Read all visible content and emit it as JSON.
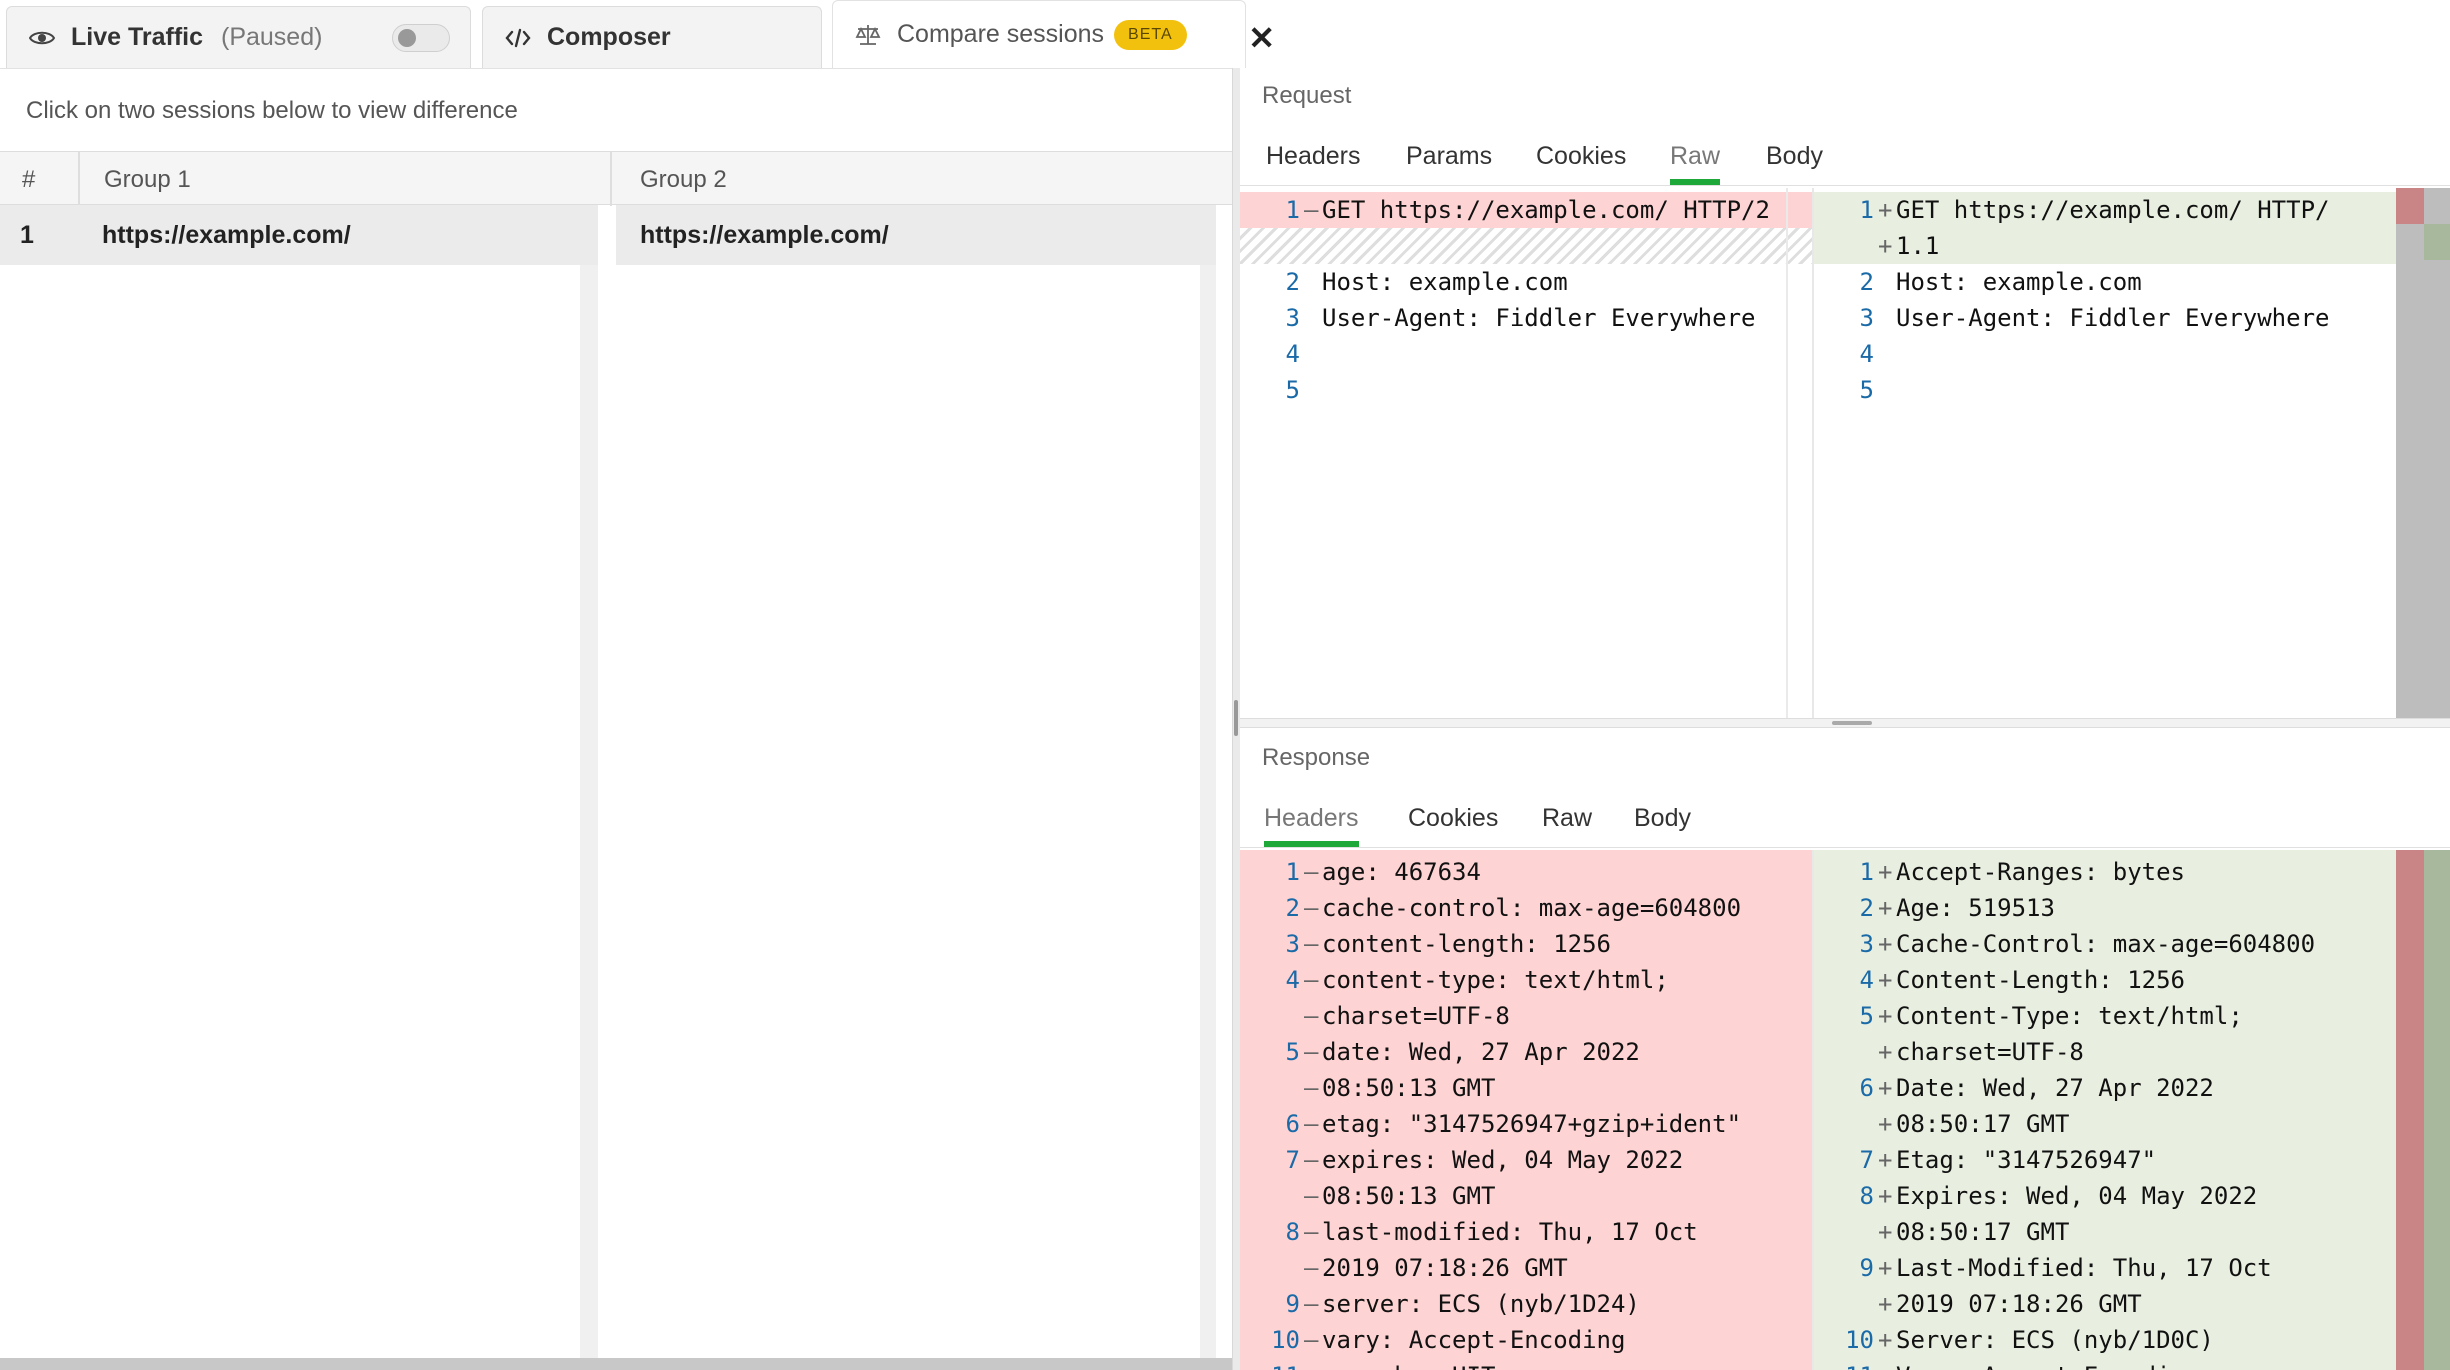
{
  "tabs": {
    "live_label": "Live Traffic",
    "live_state": "(Paused)",
    "composer_label": "Composer",
    "compare_label": "Compare sessions",
    "compare_badge": "BETA",
    "close_glyph": "✕"
  },
  "left": {
    "hint": "Click on two sessions below to view difference",
    "columns": {
      "hash": "#",
      "group1": "Group 1",
      "group2": "Group 2"
    },
    "rows": [
      {
        "num": "1",
        "group1": "https://example.com/",
        "group2": "https://example.com/"
      }
    ]
  },
  "request": {
    "title": "Request",
    "tabs": [
      "Headers",
      "Params",
      "Cookies",
      "Raw",
      "Body"
    ],
    "active_tab": "Raw",
    "left_lines": [
      {
        "ln": "1",
        "mk": "—",
        "text": "GET https://example.com/ HTTP/2",
        "type": "del"
      },
      {
        "ln": "",
        "mk": "",
        "text": "",
        "type": "hatch"
      },
      {
        "ln": "2",
        "mk": "",
        "text": "Host: example.com",
        "type": "same"
      },
      {
        "ln": "3",
        "mk": "",
        "text": "User-Agent: Fiddler Everywhere",
        "type": "same"
      },
      {
        "ln": "4",
        "mk": "",
        "text": "",
        "type": "same"
      },
      {
        "ln": "5",
        "mk": "",
        "text": "",
        "type": "same"
      }
    ],
    "right_lines": [
      {
        "ln": "1",
        "mk": "+",
        "text": "GET https://example.com/ HTTP/",
        "type": "add"
      },
      {
        "ln": "",
        "mk": "+",
        "text": "1.1",
        "type": "add"
      },
      {
        "ln": "2",
        "mk": "",
        "text": "Host: example.com",
        "type": "same"
      },
      {
        "ln": "3",
        "mk": "",
        "text": "User-Agent: Fiddler Everywhere",
        "type": "same"
      },
      {
        "ln": "4",
        "mk": "",
        "text": "",
        "type": "same"
      },
      {
        "ln": "5",
        "mk": "",
        "text": "",
        "type": "same"
      }
    ]
  },
  "response": {
    "title": "Response",
    "tabs": [
      "Headers",
      "Cookies",
      "Raw",
      "Body"
    ],
    "active_tab": "Headers",
    "left_lines": [
      {
        "ln": "1",
        "mk": "—",
        "text": "age: 467634"
      },
      {
        "ln": "2",
        "mk": "—",
        "text": "cache-control: max-age=604800"
      },
      {
        "ln": "3",
        "mk": "—",
        "text": "content-length: 1256"
      },
      {
        "ln": "4",
        "mk": "—",
        "text": "content-type: text/html;"
      },
      {
        "ln": "",
        "mk": "—",
        "text": "charset=UTF-8"
      },
      {
        "ln": "5",
        "mk": "—",
        "text": "date: Wed, 27 Apr 2022"
      },
      {
        "ln": "",
        "mk": "—",
        "text": "08:50:13 GMT"
      },
      {
        "ln": "6",
        "mk": "—",
        "text": "etag: \"3147526947+gzip+ident\""
      },
      {
        "ln": "7",
        "mk": "—",
        "text": "expires: Wed, 04 May 2022"
      },
      {
        "ln": "",
        "mk": "—",
        "text": "08:50:13 GMT"
      },
      {
        "ln": "8",
        "mk": "—",
        "text": "last-modified: Thu, 17 Oct"
      },
      {
        "ln": "",
        "mk": "—",
        "text": "2019 07:18:26 GMT"
      },
      {
        "ln": "9",
        "mk": "—",
        "text": "server: ECS (nyb/1D24)"
      },
      {
        "ln": "10",
        "mk": "—",
        "text": "vary: Accept-Encoding"
      },
      {
        "ln": "11",
        "mk": "—",
        "text": "x-cache: HIT"
      }
    ],
    "right_lines": [
      {
        "ln": "1",
        "mk": "+",
        "text": "Accept-Ranges: bytes"
      },
      {
        "ln": "2",
        "mk": "+",
        "text": "Age: 519513"
      },
      {
        "ln": "3",
        "mk": "+",
        "text": "Cache-Control: max-age=604800"
      },
      {
        "ln": "4",
        "mk": "+",
        "text": "Content-Length: 1256"
      },
      {
        "ln": "5",
        "mk": "+",
        "text": "Content-Type: text/html;"
      },
      {
        "ln": "",
        "mk": "+",
        "text": "charset=UTF-8"
      },
      {
        "ln": "6",
        "mk": "+",
        "text": "Date: Wed, 27 Apr 2022"
      },
      {
        "ln": "",
        "mk": "+",
        "text": "08:50:17 GMT"
      },
      {
        "ln": "7",
        "mk": "+",
        "text": "Etag: \"3147526947\""
      },
      {
        "ln": "8",
        "mk": "+",
        "text": "Expires: Wed, 04 May 2022"
      },
      {
        "ln": "",
        "mk": "+",
        "text": "08:50:17 GMT"
      },
      {
        "ln": "9",
        "mk": "+",
        "text": "Last-Modified: Thu, 17 Oct"
      },
      {
        "ln": "",
        "mk": "+",
        "text": "2019 07:18:26 GMT"
      },
      {
        "ln": "10",
        "mk": "+",
        "text": "Server: ECS (nyb/1D0C)"
      },
      {
        "ln": "11",
        "mk": "+",
        "text": "Vary: Accept-Encoding"
      }
    ]
  },
  "colors": {
    "accent_green": "#1fa83a",
    "beta_badge": "#f2c10e",
    "deleted_bg": "#fdd3d3",
    "added_bg": "#e8efe0",
    "line_number": "#1b6aa8"
  }
}
